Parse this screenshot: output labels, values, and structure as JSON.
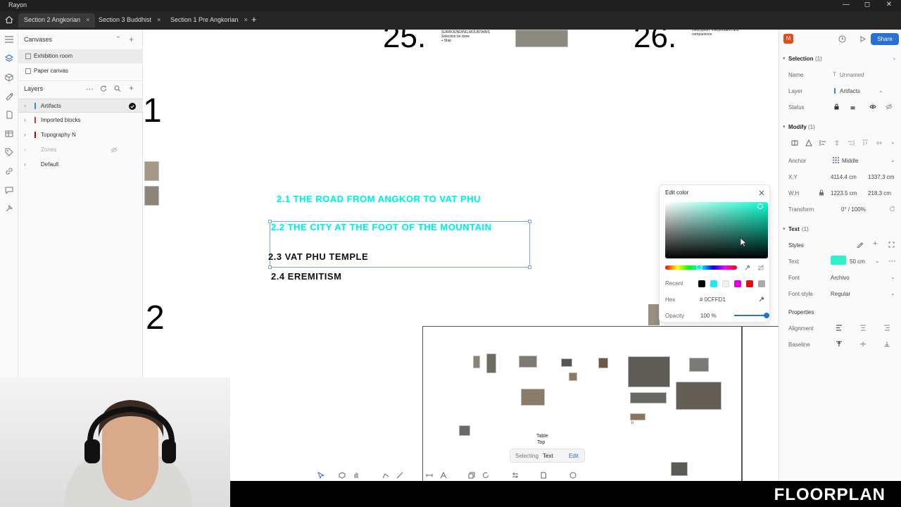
{
  "app": {
    "title": "Rayon"
  },
  "window_controls": {
    "minimize": "—",
    "maximize": "◻",
    "close": "✕"
  },
  "tabs": [
    {
      "label": "Section 2 Angkorian",
      "close": "×"
    },
    {
      "label": "Section 3 Buddhist",
      "close": "×"
    },
    {
      "label": "Section 1 Pre Angkorian",
      "close": "×"
    }
  ],
  "tabs_add": "+",
  "left_panel": {
    "canvases_title": "Canvases",
    "canvases": [
      "Exhibition room",
      "Paper canvas"
    ],
    "layers_title": "Layers",
    "layers": [
      {
        "label": "Artifacts",
        "color": "#3b82f6"
      },
      {
        "label": "Imported blocks",
        "color": "#d63b3b"
      },
      {
        "label": "Topography N",
        "color": "#c40000"
      },
      {
        "label": "Zones",
        "color": "#bbbbbb"
      },
      {
        "label": "Default",
        "color": "#bbbbbb"
      }
    ]
  },
  "canvas": {
    "num_25": "25.",
    "num_26": "26.",
    "note_25": "SURROUNDING MOUNTAINS\nSelection be done\n+ Map",
    "note_26": "Description, interpretation and\ncomparisons",
    "num_1": "1",
    "num_2": "2",
    "headings": [
      "2.1 THE ROAD FROM ANGKOR TO VAT PHU",
      "2.2 THE CITY AT THE FOOT OF THE MOUNTAIN",
      "2.3 VAT PHU TEMPLE",
      "2.4 EREMITISM"
    ],
    "table_label_1": "Table",
    "table_label_2": "Top",
    "small_label": "II",
    "selecting_label": "Selecting",
    "selecting_value": "Text",
    "edit_label": "Edit"
  },
  "color_popup": {
    "title": "Edit color",
    "recent_label": "Recent",
    "recent": [
      "#000000",
      "#22e8f0",
      "#f0f0f0",
      "#e000e0",
      "#dd1111",
      "#aaaaaa"
    ],
    "hex_label": "Hex",
    "hex_value": "# 0CFFD1",
    "opacity_label": "Opacity",
    "opacity_value": "100 %",
    "opacity": 1.0
  },
  "right_panel": {
    "avatar": "M",
    "share": "Share",
    "selection_title": "Selection",
    "selection_count": "(1)",
    "name_label": "Name",
    "name_value": "Unnamed",
    "layer_label": "Layer",
    "layer_value": "Artifacts",
    "status_label": "Status",
    "modify_title": "Modify",
    "modify_count": "(1)",
    "anchor_label": "Anchor",
    "anchor_value": "Middle",
    "xy_label": "X,Y",
    "x_value": "4114.4 cm",
    "y_value": "1337.3 cm",
    "wh_label": "W,H",
    "w_value": "1223.5 cm",
    "h_value": "218.3 cm",
    "transform_label": "Transform",
    "transform_value": "0° / 100%",
    "text_title": "Text",
    "text_count": "(1)",
    "styles_label": "Styles",
    "text_label": "Text",
    "text_size": "50 cm",
    "text_color": "#2ef2c8",
    "font_label": "Font",
    "font_value": "Archivo",
    "fontstyle_label": "Font style",
    "fontstyle_value": "Regular",
    "properties_title": "Properties",
    "alignment_label": "Alignment",
    "baseline_label": "Baseline"
  },
  "brand": "FLOORPLAN"
}
